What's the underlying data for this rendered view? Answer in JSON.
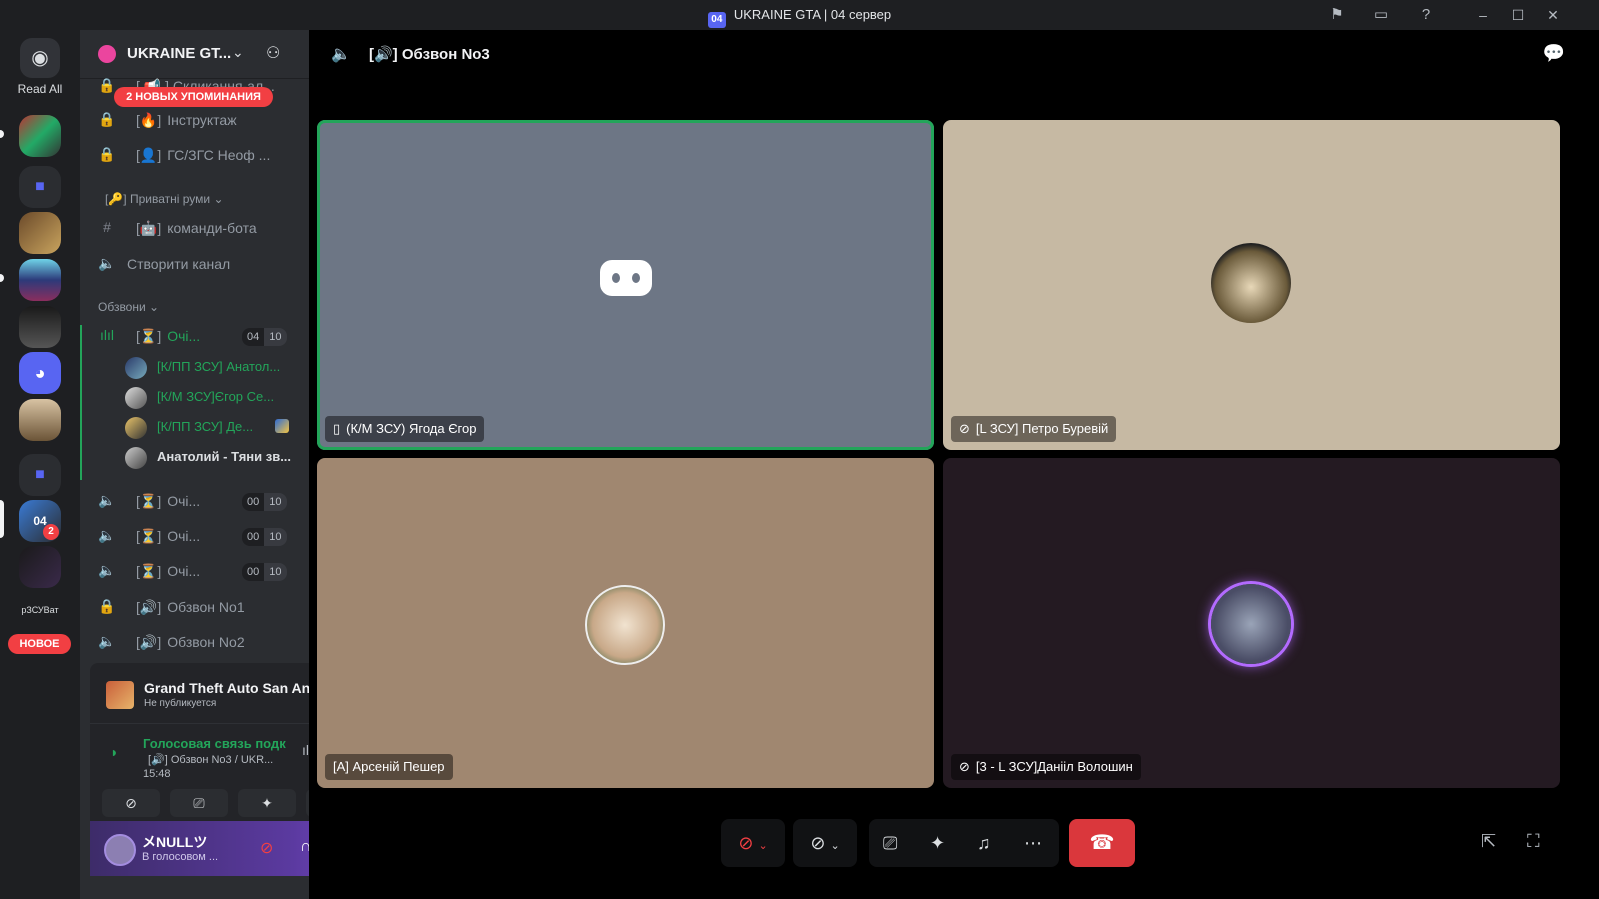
{
  "window": {
    "title": "UKRAINE GTA | 04 сервер",
    "logo_text": "04"
  },
  "rail": {
    "read_all": "Read All",
    "mention_badge": "2",
    "server_label": "рЗСУВат",
    "new_badge": "НОВОЕ"
  },
  "guild": {
    "name": "UKRAINE GT...",
    "mentions_banner": "2 НОВЫХ УПОМИНАНИЯ"
  },
  "channels": {
    "locked_top": "[ 📢 ] Скликання-ал...",
    "instruktazh": "Інструктаж",
    "gs_zgs": "ГС/ЗГС Неоф ...",
    "private_rooms": "Приватні руми",
    "bot_commands": "команди-бота",
    "create_channel": "Створити канал",
    "category_obzvony": "Обзвони",
    "queue_active": "Очі...",
    "queue_active_count": "04",
    "queue_active_limit": "10",
    "queue_2": "Очі...",
    "queue_2_count": "00",
    "queue_2_limit": "10",
    "queue_3": "Очі...",
    "queue_3_count": "00",
    "queue_3_limit": "10",
    "queue_4": "Очі...",
    "queue_4_count": "00",
    "queue_4_limit": "10",
    "obzvon_1": "Обзвон No1",
    "obzvon_2": "Обзвон No2"
  },
  "voice_members": [
    "[К/ПП ЗСУ] Анатол...",
    "[К/М ЗСУ]Єгор Се...",
    "[К/ПП ЗСУ] Де...",
    "Анатолий - Тяни зв..."
  ],
  "activity": {
    "game_title": "Grand Theft Auto San And...",
    "game_subtitle": "Не публикуется"
  },
  "voice_status": {
    "status": "Голосовая связь подк",
    "channel": "[🔊] Обзвон No3 / UKR...",
    "time": "15:48"
  },
  "user": {
    "name": "メNULLツ",
    "status": "В голосовом ..."
  },
  "main": {
    "channel_title": "[🔊] Обзвон No3"
  },
  "tiles": [
    {
      "label": "(К/М ЗСУ) Ягода Єгор",
      "icon": "phone-icon"
    },
    {
      "label": "[L ЗСУ] Петро Буревій",
      "icon": "mic-muted-icon"
    },
    {
      "label": "[А] Арсеній Пешер",
      "icon": ""
    },
    {
      "label": "[3 - L ЗСУ]Данііл Волошин",
      "icon": "mic-muted-icon"
    }
  ],
  "colors": {
    "accent": "#5865f2",
    "speaking_green": "#23a55a",
    "danger_red": "#da373c",
    "tile1_bg": "#6d7685",
    "tile2_bg": "#c6b9a3",
    "tile3_bg": "#a08770",
    "tile4_bg": "#241a22"
  }
}
